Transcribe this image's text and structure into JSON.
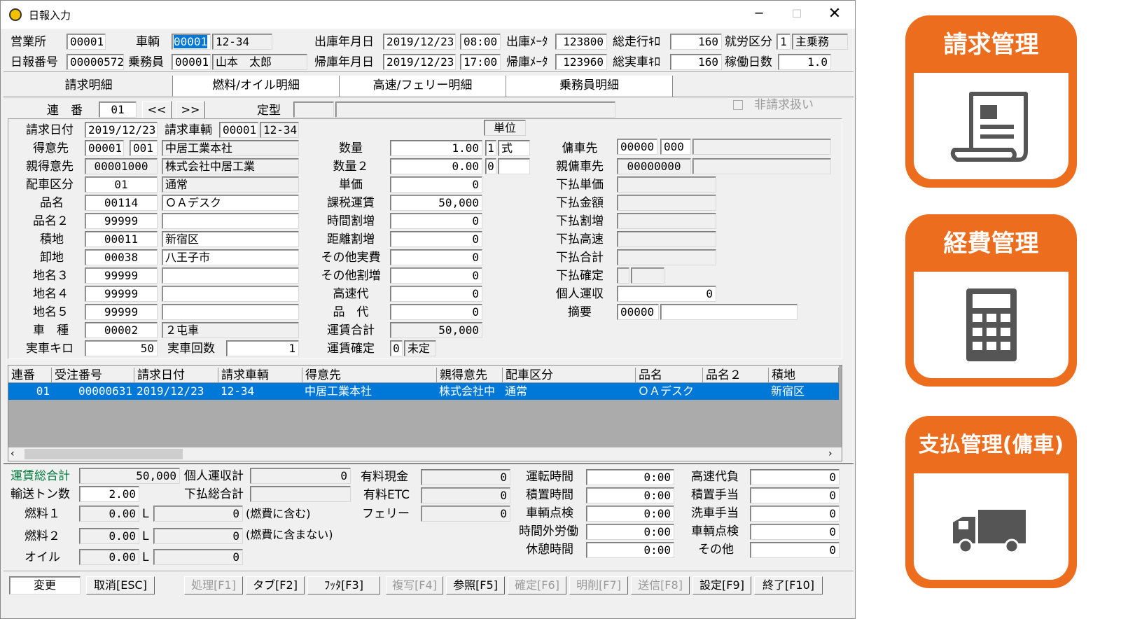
{
  "window": {
    "title": "日報入力"
  },
  "header": {
    "eigyosho_label": "営業所",
    "eigyosho_value": "00001",
    "sharyo_label": "車輌",
    "sharyo_code": "00001",
    "sharyo_name": "12-34",
    "shukko_label": "出庫年月日",
    "shukko_date": "2019/12/23",
    "shukko_time": "08:00",
    "shukko_meter_label": "出庫ﾒｰﾀ",
    "shukko_meter": "123800",
    "sosoko_label": "総走行ｷﾛ",
    "sosoko_value": "160",
    "shuro_label": "就労区分",
    "shuro_code": "1",
    "shuro_name": "主乗務",
    "nippo_label": "日報番号",
    "nippo_value": "00000572",
    "jomuin_label": "乗務員",
    "jomuin_code": "00001",
    "jomuin_name": "山本　太郎",
    "kiko_label": "帰庫年月日",
    "kiko_date": "2019/12/23",
    "kiko_time": "17:00",
    "kiko_meter_label": "帰庫ﾒｰﾀ",
    "kiko_meter": "123960",
    "sojitsu_label": "総実車ｷﾛ",
    "sojitsu_value": "160",
    "kado_label": "稼働日数",
    "kado_value": "1.0"
  },
  "tabs": [
    "請求明細",
    "燃料/オイル明細",
    "高速/フェリー明細",
    "乗務員明細"
  ],
  "detail_nav": {
    "renban_label": "連　番",
    "renban_value": "01",
    "prev_label": "<<",
    "next_label": ">>",
    "teikei_label": "定型",
    "hiseikyu_label": "非請求扱い"
  },
  "left_form": {
    "seikyu_date_label": "請求日付",
    "seikyu_date": "2019/12/23",
    "seikyu_sharyo_label": "請求車輌",
    "seikyu_sharyo_code": "00001",
    "seikyu_sharyo_name": "12-34",
    "tokuisaki_label": "得意先",
    "tokuisaki_code": "00001",
    "tokuisaki_sub": "001",
    "tokuisaki_name": "中居工業本社",
    "oya_label": "親得意先",
    "oya_code": "00001000",
    "oya_name": "株式会社中居工業",
    "haisha_label": "配車区分",
    "haisha_code": "01",
    "haisha_name": "通常",
    "hinmei_label": "品名",
    "hinmei_code": "00114",
    "hinmei_name": "ＯＡデスク",
    "hinmei2_label": "品名２",
    "hinmei2_code": "99999",
    "tsumi_label": "積地",
    "tsumi_code": "00011",
    "tsumi_name": "新宿区",
    "oroshi_label": "卸地",
    "oroshi_code": "00038",
    "oroshi_name": "八王子市",
    "chimei3_label": "地名３",
    "chimei3_code": "99999",
    "chimei4_label": "地名４",
    "chimei4_code": "99999",
    "chimei5_label": "地名５",
    "chimei5_code": "99999",
    "shashu_label": "車　種",
    "shashu_code": "00002",
    "shashu_name": "２屯車",
    "jissha_km_label": "実車キロ",
    "jissha_km": "50",
    "jissha_kaisu_label": "実車回数",
    "jissha_kaisu": "1"
  },
  "mid_form": {
    "tani_label": "単位",
    "suryo_label": "数量",
    "suryo": "1.00",
    "suryo_unit_code": "1",
    "suryo_unit": "式",
    "suryo2_label": "数量２",
    "suryo2": "0.00",
    "suryo2_unit_code": "0",
    "tanka_label": "単価",
    "tanka": "0",
    "kazei_label": "課税運賃",
    "kazei": "50,000",
    "jikan_label": "時間割増",
    "jikan": "0",
    "kyori_label": "距離割増",
    "kyori": "0",
    "sonota_jippi_label": "その他実費",
    "sonota_jippi": "0",
    "sonota_wari_label": "その他割増",
    "sonota_wari": "0",
    "kosoku_label": "高速代",
    "kosoku": "0",
    "hindai_label": "品　代",
    "hindai": "0",
    "unchin_total_label": "運賃合計",
    "unchin_total": "50,000",
    "unchin_kakutei_label": "運賃確定",
    "unchin_kakutei_code": "0",
    "unchin_kakutei": "未定"
  },
  "right_form": {
    "yosha_label": "傭車先",
    "yosha_code": "00000",
    "yosha_sub": "000",
    "oya_yosha_label": "親傭車先",
    "oya_yosha_code": "00000000",
    "shita_tanka_label": "下払単価",
    "shita_kingaku_label": "下払金額",
    "shita_wari_label": "下払割増",
    "shita_kosoku_label": "下払高速",
    "shita_total_label": "下払合計",
    "shita_kakutei_label": "下払確定",
    "kojin_label": "個人運収",
    "kojin": "0",
    "tekiyo_label": "摘要",
    "tekiyo_code": "00000"
  },
  "grid": {
    "headers": [
      "連番",
      "受注番号",
      "請求日付",
      "請求車輌",
      "得意先",
      "親得意先",
      "配車区分",
      "品名",
      "品名２",
      "積地"
    ],
    "row": [
      "01",
      "00000631",
      "2019/12/23",
      "12-34",
      "中居工業本社",
      "株式会社中",
      "通常",
      "ＯＡデスク",
      "",
      "新宿区"
    ]
  },
  "summary": {
    "unchin_sogokei_label": "運賃総合計",
    "unchin_sogokei": "50,000",
    "kojin_total_label": "個人運収計",
    "kojin_total": "0",
    "ton_label": "輸送トン数",
    "ton": "2.00",
    "shita_sogokei_label": "下払総合計",
    "nenryo1_label": "燃料１",
    "nenryo1": "0.00",
    "nenryo1_val": "0",
    "nenryo1_note": "(燃費に含む)",
    "nenryo2_label": "燃料２",
    "nenryo2": "0.00",
    "nenryo2_val": "0",
    "nenryo2_note": "(燃費に含まない)",
    "oil_label": "オイル",
    "oil": "0.00",
    "oil_val": "0",
    "liter_unit": "L",
    "yuryo_genkin_label": "有料現金",
    "yuryo_genkin": "0",
    "yuryo_etc_label": "有料ETC",
    "yuryo_etc": "0",
    "ferry_label": "フェリー",
    "ferry": "0",
    "unten_label": "運転時間",
    "unten": "0:00",
    "tsumioki_label": "積置時間",
    "tsumioki": "0:00",
    "tenken_label": "車輌点検",
    "tenken": "0:00",
    "jikangai_label": "時間外労働",
    "jikangai": "0:00",
    "kyukei_label": "休憩時間",
    "kyukei": "0:00",
    "kosoku_daifu_label": "高速代負",
    "kosoku_daifu": "0",
    "tsumioki_teate_label": "積置手当",
    "tsumioki_teate": "0",
    "sensha_label": "洗車手当",
    "sensha": "0",
    "tenken2_label": "車輌点検",
    "tenken2": "0",
    "sonota_label": "その他",
    "sonota": "0"
  },
  "footer_buttons": [
    "変更",
    "取消[ESC]",
    "処理[F1]",
    "タブ[F2]",
    "ﾌｯﾀ[F3]",
    "複写[F4]",
    "参照[F5]",
    "確定[F6]",
    "明削[F7]",
    "送信[F8]",
    "設定[F9]",
    "終了[F10]"
  ],
  "side_cards": [
    {
      "title": "請求管理",
      "icon": "invoice-scroll-icon"
    },
    {
      "title": "経費管理",
      "icon": "calculator-icon"
    },
    {
      "title": "支払管理(傭車)",
      "icon": "truck-icon"
    }
  ],
  "colors": {
    "accent": "#ed6d1f",
    "selection": "#0078d7",
    "icon_gray": "#555555"
  }
}
